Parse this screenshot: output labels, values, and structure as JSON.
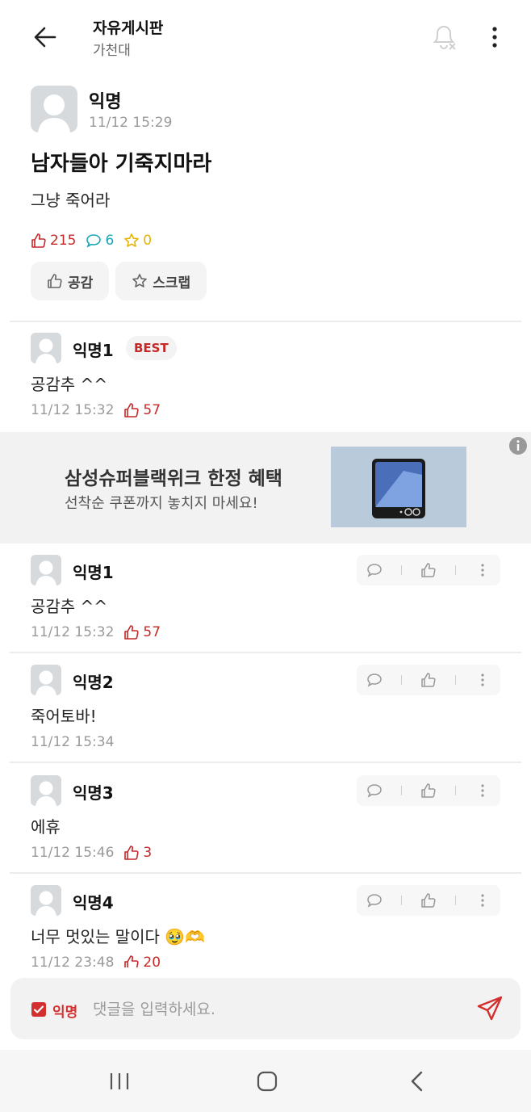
{
  "header": {
    "title": "자유게시판",
    "subtitle": "가천대"
  },
  "post": {
    "author": "익명",
    "time": "11/12 15:29",
    "title": "남자들아 기죽지마라",
    "body": "그냥 죽어라",
    "likes": "215",
    "comments": "6",
    "scraps": "0",
    "like_button": "공감",
    "scrap_button": "스크랩"
  },
  "best_comment": {
    "author": "익명1",
    "badge": "BEST",
    "body": "공감추 ^^",
    "time": "11/12 15:32",
    "likes": "57"
  },
  "ad": {
    "title": "삼성슈퍼블랙위크 한정 혜택",
    "subtitle": "선착순 쿠폰까지 놓치지 마세요!"
  },
  "comments": [
    {
      "author": "익명1",
      "body": "공감추 ^^",
      "time": "11/12 15:32",
      "likes": "57"
    },
    {
      "author": "익명2",
      "body": "죽어토바!",
      "time": "11/12 15:34",
      "likes": ""
    },
    {
      "author": "익명3",
      "body": "에휴",
      "time": "11/12 15:46",
      "likes": "3"
    },
    {
      "author": "익명4",
      "body": "너무 멋있는 말이다 🥹🫶",
      "time": "11/12 23:48",
      "likes": "20"
    }
  ],
  "input": {
    "anon_label": "익명",
    "placeholder": "댓글을 입력하세요."
  },
  "colors": {
    "accent": "#c62828",
    "comment": "#18a5b5",
    "scrap": "#e6b400"
  }
}
